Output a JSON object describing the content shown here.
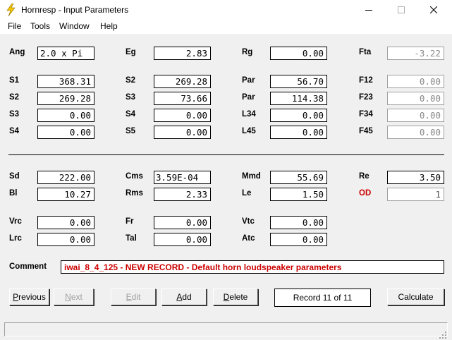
{
  "window": {
    "title": "Hornresp - Input Parameters",
    "app_icon": "lightning-icon",
    "controls": {
      "minimize_icon": "minimize-icon",
      "maximize_icon": "maximize-icon",
      "close_icon": "close-icon"
    }
  },
  "menu": [
    "File",
    "Tools",
    "Window",
    "Help"
  ],
  "params": {
    "ang": {
      "label": "Ang",
      "value": "2.0 x Pi"
    },
    "eg": {
      "label": "Eg",
      "value": "2.83"
    },
    "rg": {
      "label": "Rg",
      "value": "0.00"
    },
    "fta": {
      "label": "Fta",
      "value": "-3.22"
    },
    "s1": {
      "label": "S1",
      "value": "368.31"
    },
    "s2a": {
      "label": "S2",
      "value": "269.28"
    },
    "par1": {
      "label": "Par",
      "value": "56.70"
    },
    "f12": {
      "label": "F12",
      "value": "0.00"
    },
    "s2b": {
      "label": "S2",
      "value": "269.28"
    },
    "s3a": {
      "label": "S3",
      "value": "73.66"
    },
    "par2": {
      "label": "Par",
      "value": "114.38"
    },
    "f23": {
      "label": "F23",
      "value": "0.00"
    },
    "s3b": {
      "label": "S3",
      "value": "0.00"
    },
    "s4a": {
      "label": "S4",
      "value": "0.00"
    },
    "l34": {
      "label": "L34",
      "value": "0.00"
    },
    "f34": {
      "label": "F34",
      "value": "0.00"
    },
    "s4b": {
      "label": "S4",
      "value": "0.00"
    },
    "s5": {
      "label": "S5",
      "value": "0.00"
    },
    "l45": {
      "label": "L45",
      "value": "0.00"
    },
    "f45": {
      "label": "F45",
      "value": "0.00"
    },
    "sd": {
      "label": "Sd",
      "value": "222.00"
    },
    "cms": {
      "label": "Cms",
      "value": "3.59E-04"
    },
    "mmd": {
      "label": "Mmd",
      "value": "55.69"
    },
    "re": {
      "label": "Re",
      "value": "3.50"
    },
    "bl": {
      "label": "Bl",
      "value": "10.27"
    },
    "rms": {
      "label": "Rms",
      "value": "2.33"
    },
    "le": {
      "label": "Le",
      "value": "1.50"
    },
    "od": {
      "label": "OD",
      "value": "1"
    },
    "vrc": {
      "label": "Vrc",
      "value": "0.00"
    },
    "fr": {
      "label": "Fr",
      "value": "0.00"
    },
    "vtc": {
      "label": "Vtc",
      "value": "0.00"
    },
    "lrc": {
      "label": "Lrc",
      "value": "0.00"
    },
    "tal": {
      "label": "Tal",
      "value": "0.00"
    },
    "atc": {
      "label": "Atc",
      "value": "0.00"
    }
  },
  "comment": {
    "label": "Comment",
    "value": "iwai_8_4_125 - NEW RECORD - Default horn loudspeaker parameters"
  },
  "buttons": {
    "previous": {
      "first": "P",
      "rest": "revious"
    },
    "next": {
      "first": "N",
      "rest": "ext"
    },
    "edit": {
      "first": "E",
      "rest": "dit"
    },
    "add": {
      "first": "A",
      "rest": "dd"
    },
    "delete": {
      "first": "D",
      "rest": "elete"
    },
    "calculate": {
      "first": "",
      "rest": "Calculate"
    }
  },
  "record": "Record 11 of 11",
  "colors": {
    "accent_red": "#cc0000",
    "title_icon": "#f5c400"
  }
}
